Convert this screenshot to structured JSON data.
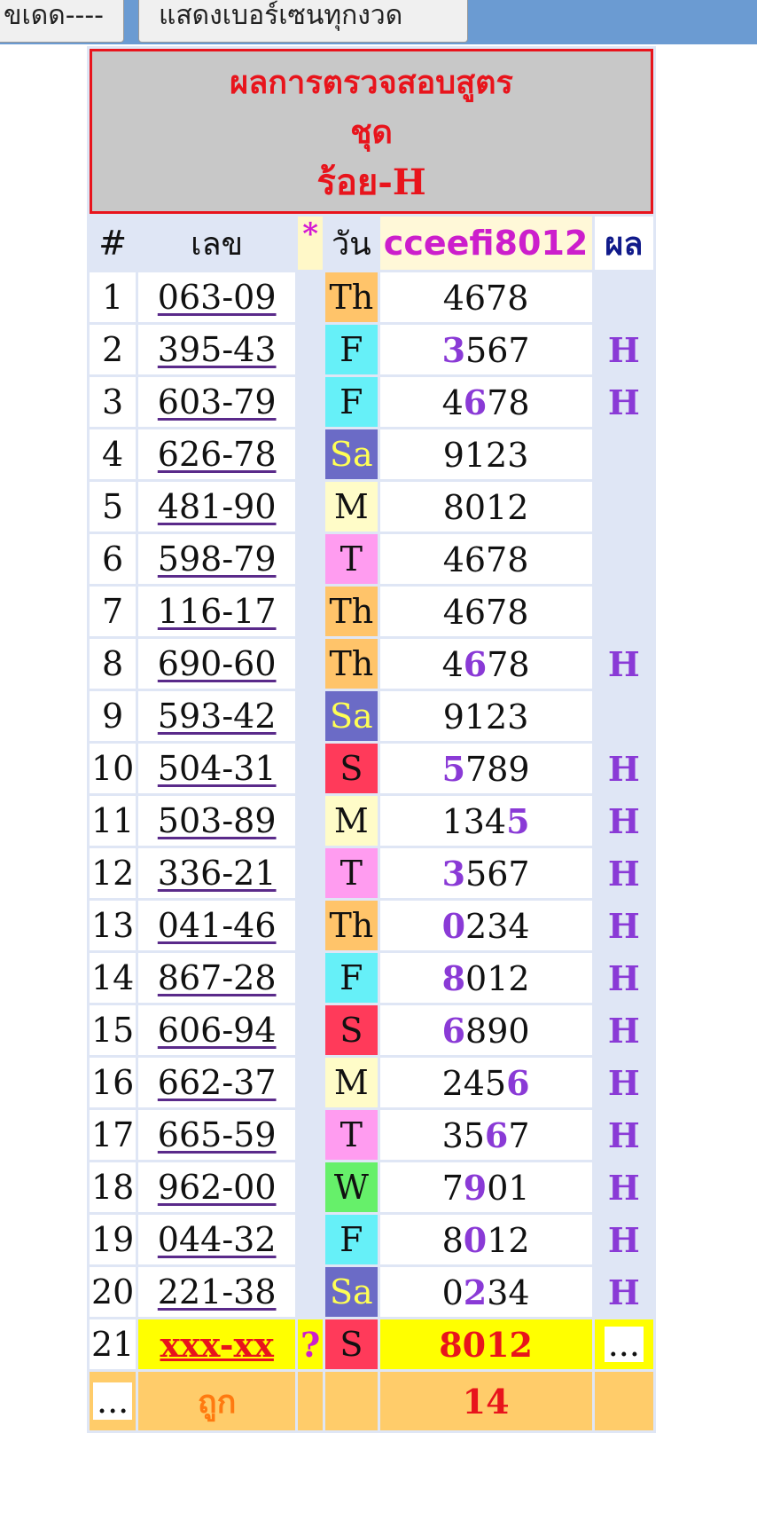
{
  "topbar": {
    "left_button": "ขเดด----",
    "right_button": "แสดงเบอร์เซนทุกงวด"
  },
  "title": {
    "line1": "ผลการตรวจสอบสูตร",
    "line2": "ชุด",
    "line3": "ร้อย-H"
  },
  "header": {
    "idx": "#",
    "number": "เลข",
    "star": "*",
    "day": "วัน",
    "formula": "cceefi8012",
    "result": "ผล"
  },
  "rows": [
    {
      "idx": "1",
      "number": "063-09",
      "day": "Th",
      "pre": "",
      "hl": "",
      "post": "4678",
      "result": ""
    },
    {
      "idx": "2",
      "number": "395-43",
      "day": "F",
      "pre": "",
      "hl": "3",
      "post": "567",
      "result": "H"
    },
    {
      "idx": "3",
      "number": "603-79",
      "day": "F",
      "pre": "4",
      "hl": "6",
      "post": "78",
      "result": "H"
    },
    {
      "idx": "4",
      "number": "626-78",
      "day": "Sa",
      "pre": "",
      "hl": "",
      "post": "9123",
      "result": ""
    },
    {
      "idx": "5",
      "number": "481-90",
      "day": "M",
      "pre": "",
      "hl": "",
      "post": "8012",
      "result": ""
    },
    {
      "idx": "6",
      "number": "598-79",
      "day": "T",
      "pre": "",
      "hl": "",
      "post": "4678",
      "result": ""
    },
    {
      "idx": "7",
      "number": "116-17",
      "day": "Th",
      "pre": "",
      "hl": "",
      "post": "4678",
      "result": ""
    },
    {
      "idx": "8",
      "number": "690-60",
      "day": "Th",
      "pre": "4",
      "hl": "6",
      "post": "78",
      "result": "H"
    },
    {
      "idx": "9",
      "number": "593-42",
      "day": "Sa",
      "pre": "",
      "hl": "",
      "post": "9123",
      "result": ""
    },
    {
      "idx": "10",
      "number": "504-31",
      "day": "S",
      "pre": "",
      "hl": "5",
      "post": "789",
      "result": "H"
    },
    {
      "idx": "11",
      "number": "503-89",
      "day": "M",
      "pre": "134",
      "hl": "5",
      "post": "",
      "result": "H"
    },
    {
      "idx": "12",
      "number": "336-21",
      "day": "T",
      "pre": "",
      "hl": "3",
      "post": "567",
      "result": "H"
    },
    {
      "idx": "13",
      "number": "041-46",
      "day": "Th",
      "pre": "",
      "hl": "0",
      "post": "234",
      "result": "H"
    },
    {
      "idx": "14",
      "number": "867-28",
      "day": "F",
      "pre": "",
      "hl": "8",
      "post": "012",
      "result": "H"
    },
    {
      "idx": "15",
      "number": "606-94",
      "day": "S",
      "pre": "",
      "hl": "6",
      "post": "890",
      "result": "H"
    },
    {
      "idx": "16",
      "number": "662-37",
      "day": "M",
      "pre": "245",
      "hl": "6",
      "post": "",
      "result": "H"
    },
    {
      "idx": "17",
      "number": "665-59",
      "day": "T",
      "pre": "35",
      "hl": "6",
      "post": "7",
      "result": "H"
    },
    {
      "idx": "18",
      "number": "962-00",
      "day": "W",
      "pre": "7",
      "hl": "9",
      "post": "01",
      "result": "H"
    },
    {
      "idx": "19",
      "number": "044-32",
      "day": "F",
      "pre": "8",
      "hl": "0",
      "post": "12",
      "result": "H"
    },
    {
      "idx": "20",
      "number": "221-38",
      "day": "Sa",
      "pre": "0",
      "hl": "2",
      "post": "34",
      "result": "H"
    }
  ],
  "next_row": {
    "idx": "21",
    "number": "xxx-xx",
    "star": "?",
    "day": "S",
    "formula_value": "8012",
    "result": "..."
  },
  "footer": {
    "dots": "...",
    "label": "ถูก",
    "count": "14"
  }
}
